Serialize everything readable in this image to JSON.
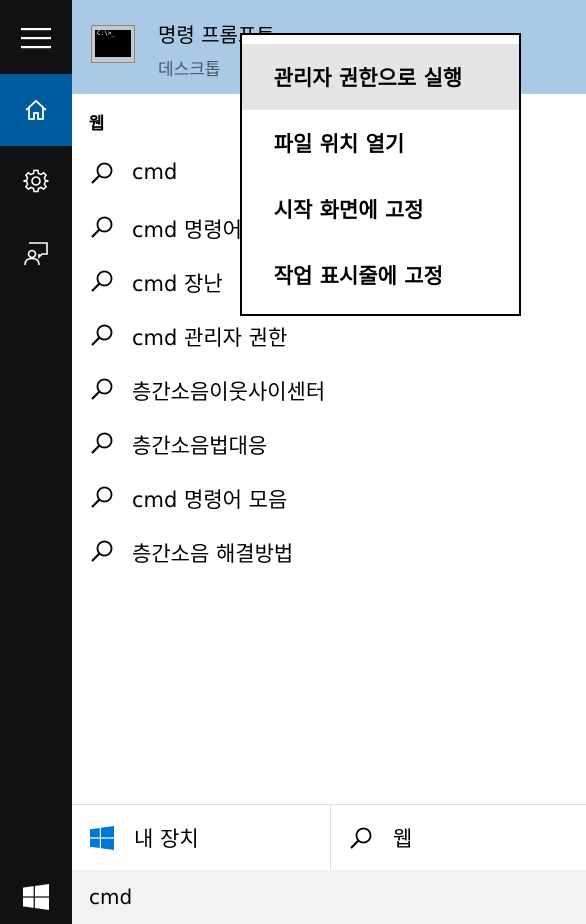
{
  "rail": {
    "items": [
      {
        "icon": "hamburger-menu-icon"
      },
      {
        "icon": "home-icon",
        "active": true
      },
      {
        "icon": "gear-icon"
      },
      {
        "icon": "feedback-icon"
      }
    ]
  },
  "best_match": {
    "title": "명령 프롬프트",
    "subtitle": "데스크톱",
    "icon_text": "C:\\>_"
  },
  "web_section": {
    "header": "웹"
  },
  "results": [
    {
      "label": "cmd"
    },
    {
      "label": "cmd 명령어"
    },
    {
      "label": "cmd 장난"
    },
    {
      "label": "cmd 관리자 권한"
    },
    {
      "label": "층간소음이웃사이센터"
    },
    {
      "label": "층간소음법대응"
    },
    {
      "label": "cmd 명령어 모음"
    },
    {
      "label": "층간소음 해결방법"
    }
  ],
  "context_menu": {
    "items": [
      {
        "label": "관리자 권한으로 실행",
        "highlighted": true
      },
      {
        "label": "파일 위치 열기"
      },
      {
        "label": "시작 화면에 고정"
      },
      {
        "label": "작업 표시줄에 고정"
      }
    ]
  },
  "filters": {
    "devices_label": "내 장치",
    "web_label": "웹"
  },
  "taskbar": {
    "search_value": "cmd"
  },
  "colors": {
    "rail_bg": "#111111",
    "accent": "#005a9e",
    "best_match_bg": "#a9c9e6",
    "windows_blue": "#0078d7"
  }
}
